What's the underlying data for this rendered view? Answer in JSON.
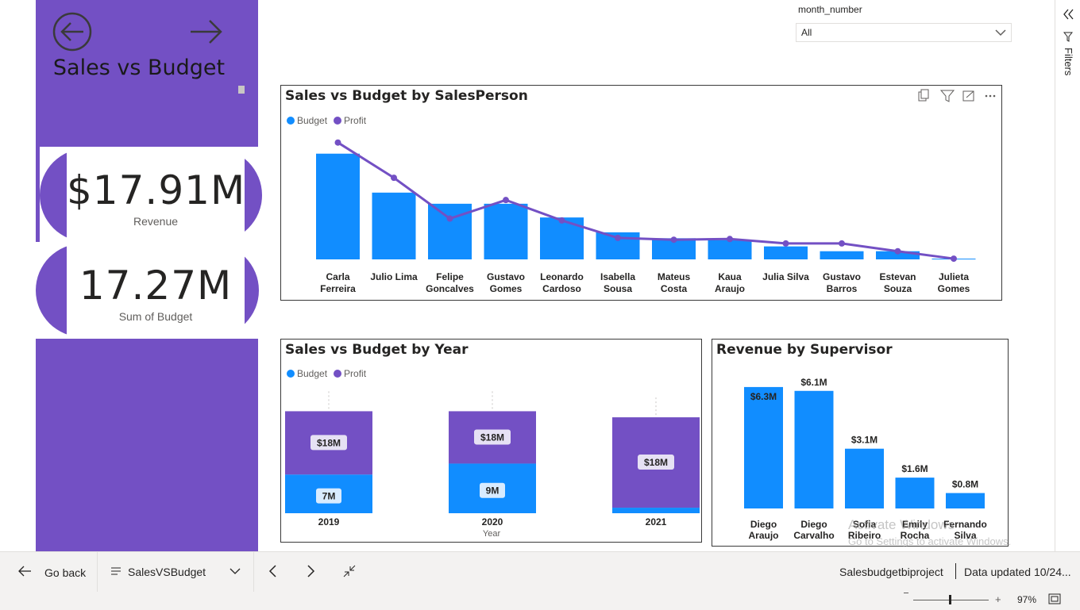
{
  "header": {
    "title": "Sales vs Budget",
    "back_icon": "circle-arrow-left-icon",
    "forward_icon": "arrow-right-icon"
  },
  "kpis": {
    "revenue_value": "$17.91M",
    "revenue_label": "Revenue",
    "budget_value": "17.27M",
    "budget_label": "Sum of Budget"
  },
  "slicer": {
    "label": "month_number",
    "value": "All"
  },
  "filters_pane": {
    "label": "Filters"
  },
  "colors": {
    "purple": "#7350c4",
    "budget": "#118dff",
    "profit": "#7350c4"
  },
  "charts": {
    "salesperson": {
      "title": "Sales vs Budget by SalesPerson",
      "legend": [
        "Budget",
        "Profit"
      ]
    },
    "year": {
      "title": "Sales vs Budget by Year",
      "legend": [
        "Budget",
        "Profit"
      ],
      "xlabel": "Year"
    },
    "supervisor": {
      "title": "Revenue by Supervisor"
    }
  },
  "chart_data": [
    {
      "type": "bar",
      "title": "Sales vs Budget by SalesPerson",
      "categories": [
        [
          "Carla",
          "Ferreira"
        ],
        [
          "Julio Lima"
        ],
        [
          "Felipe",
          "Goncalves"
        ],
        [
          "Gustavo",
          "Gomes"
        ],
        [
          "Leonardo",
          "Cardoso"
        ],
        [
          "Isabella",
          "Sousa"
        ],
        [
          "Mateus",
          "Costa"
        ],
        [
          "Kaua",
          "Araujo"
        ],
        [
          "Julia Silva"
        ],
        [
          "Gustavo",
          "Barros"
        ],
        [
          "Estevan",
          "Souza"
        ],
        [
          "Julieta",
          "Gomes"
        ]
      ],
      "series": [
        {
          "name": "Budget",
          "kind": "bar",
          "values": [
            2.85,
            1.8,
            1.5,
            1.5,
            1.13,
            0.73,
            0.57,
            0.52,
            0.35,
            0.22,
            0.22,
            0.02
          ]
        },
        {
          "name": "Profit",
          "kind": "line",
          "values": [
            3.15,
            2.2,
            1.1,
            1.6,
            1.05,
            0.58,
            0.53,
            0.55,
            0.43,
            0.43,
            0.22,
            0.02
          ]
        }
      ],
      "ylim": [
        0,
        3.4
      ]
    },
    {
      "type": "bar",
      "title": "Sales vs Budget by Year",
      "xlabel": "Year",
      "categories": [
        "2019",
        "2020",
        "2021"
      ],
      "series": [
        {
          "name": "Budget",
          "values": [
            7,
            9,
            1
          ],
          "labels": [
            "7M",
            "9M",
            ""
          ]
        },
        {
          "name": "Profit",
          "values": [
            18,
            18,
            18
          ],
          "labels": [
            "$18M",
            "$18M",
            "$18M"
          ]
        }
      ],
      "stacked_heights": [
        [
          7,
          18.5
        ],
        [
          9,
          18.5
        ],
        [
          1,
          17.4
        ]
      ],
      "ylim": [
        0,
        28
      ]
    },
    {
      "type": "bar",
      "title": "Revenue by Supervisor",
      "categories": [
        [
          "Diego",
          "Araujo"
        ],
        [
          "Diego",
          "Carvalho"
        ],
        [
          "Sofia",
          "Ribeiro"
        ],
        [
          "Emily",
          "Rocha"
        ],
        [
          "Fernando",
          "Silva"
        ]
      ],
      "values": [
        6.3,
        6.1,
        3.1,
        1.6,
        0.8
      ],
      "labels": [
        "$6.3M",
        "$6.1M",
        "$3.1M",
        "$1.6M",
        "$0.8M"
      ],
      "ylim": [
        0,
        6.5
      ]
    }
  ],
  "watermark": {
    "line1": "Activate Windows",
    "line2": "Go to Settings to activate Windows."
  },
  "bottombar": {
    "go_back": "Go back",
    "page_name": "SalesVSBudget",
    "report_name": "Salesbudgetbiproject",
    "data_updated": "Data updated 10/24...",
    "zoom": "97%"
  }
}
